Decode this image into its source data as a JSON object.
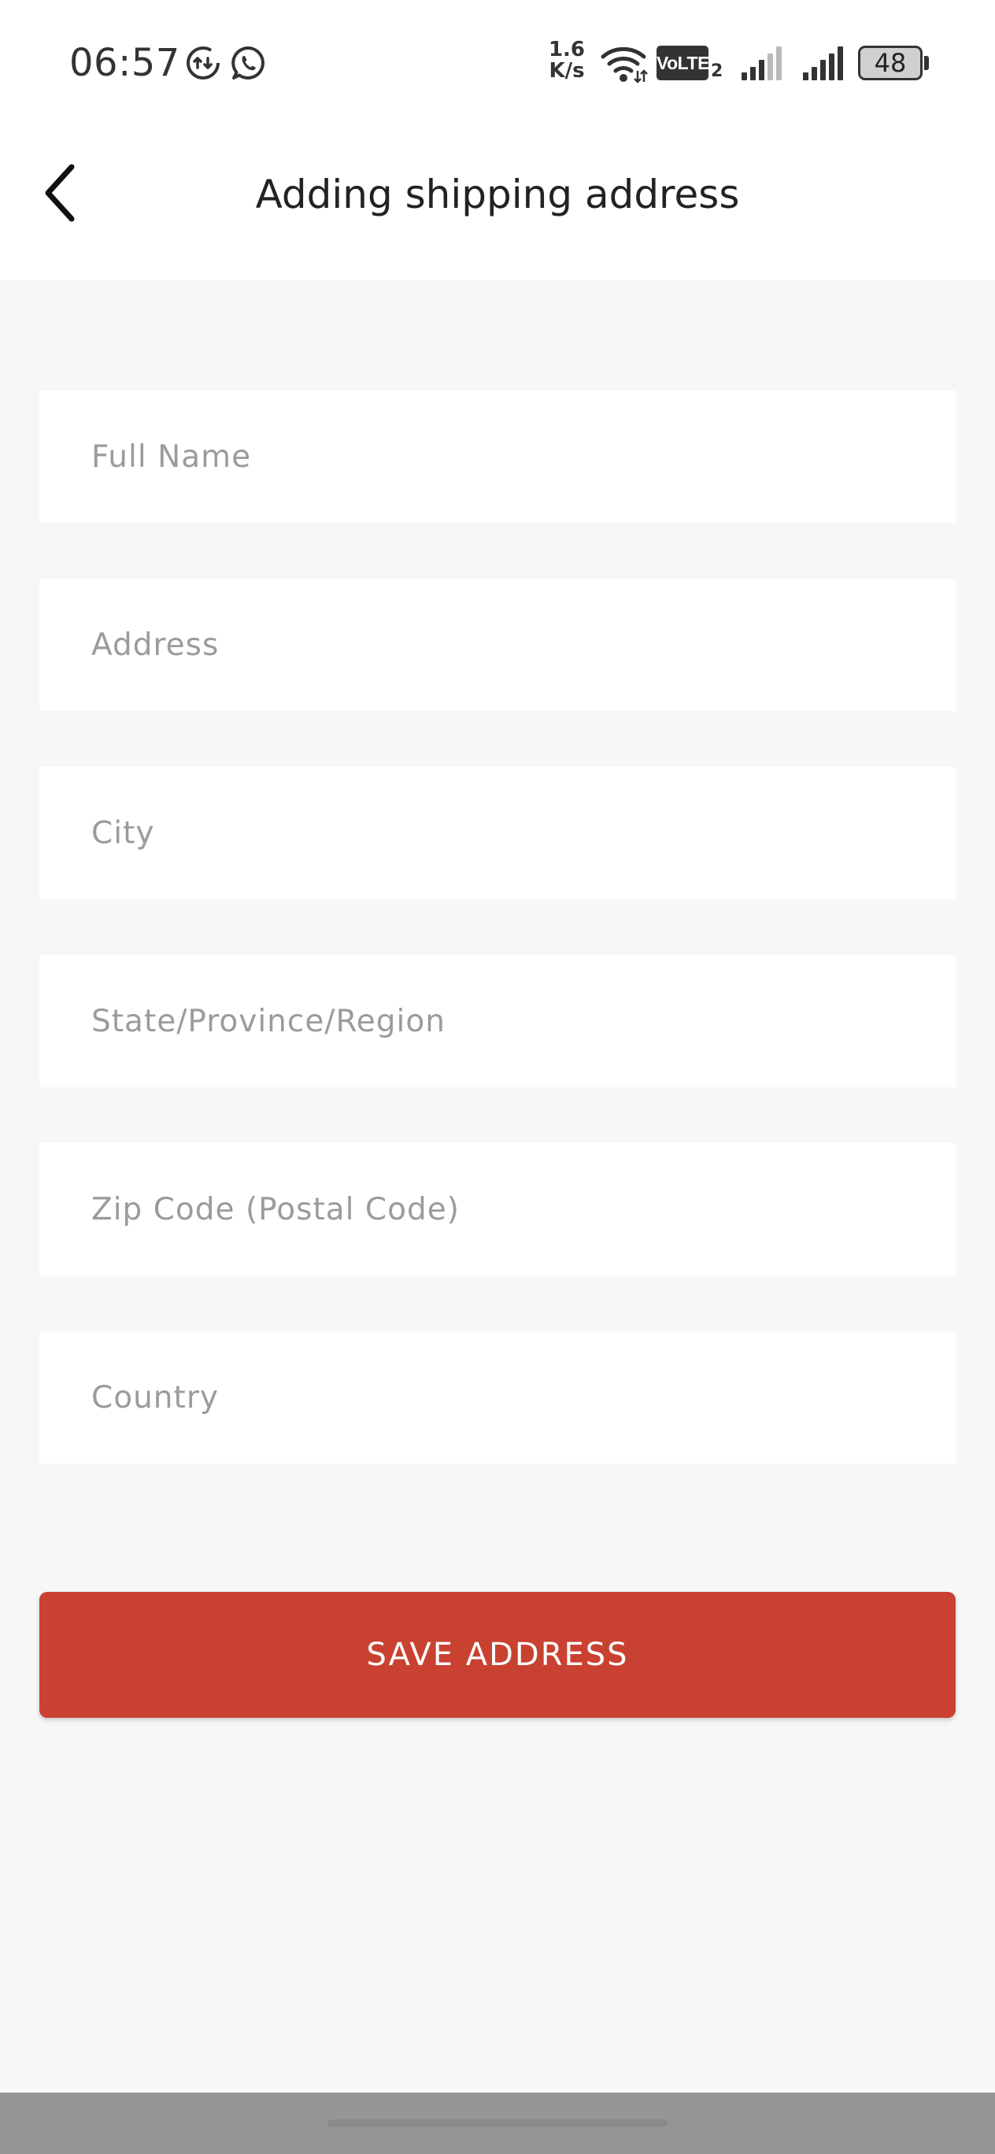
{
  "status_bar": {
    "time": "06:57",
    "net_speed_value": "1.6",
    "net_speed_unit": "K/s",
    "volte_label": "VoLTE",
    "sim_index": "2",
    "battery_level": "48",
    "icons": [
      "data-saver-icon",
      "whatsapp-icon",
      "wifi-icon",
      "volte-icon",
      "signal-sim1-icon",
      "signal-sim2-icon",
      "battery-icon"
    ]
  },
  "header": {
    "title": "Adding shipping address",
    "back_icon": "chevron-left-icon"
  },
  "form": {
    "full_name": {
      "placeholder": "Full Name",
      "value": ""
    },
    "address": {
      "placeholder": "Address",
      "value": ""
    },
    "city": {
      "placeholder": "City",
      "value": ""
    },
    "state": {
      "placeholder": "State/Province/Region",
      "value": ""
    },
    "zip": {
      "placeholder": "Zip Code (Postal Code)",
      "value": ""
    },
    "country": {
      "placeholder": "Country",
      "value": ""
    }
  },
  "actions": {
    "save_label": "SAVE ADDRESS"
  },
  "colors": {
    "accent": "#c94131",
    "background": "#f7f7f7",
    "field_background": "#ffffff",
    "placeholder": "#9b9b9b"
  }
}
